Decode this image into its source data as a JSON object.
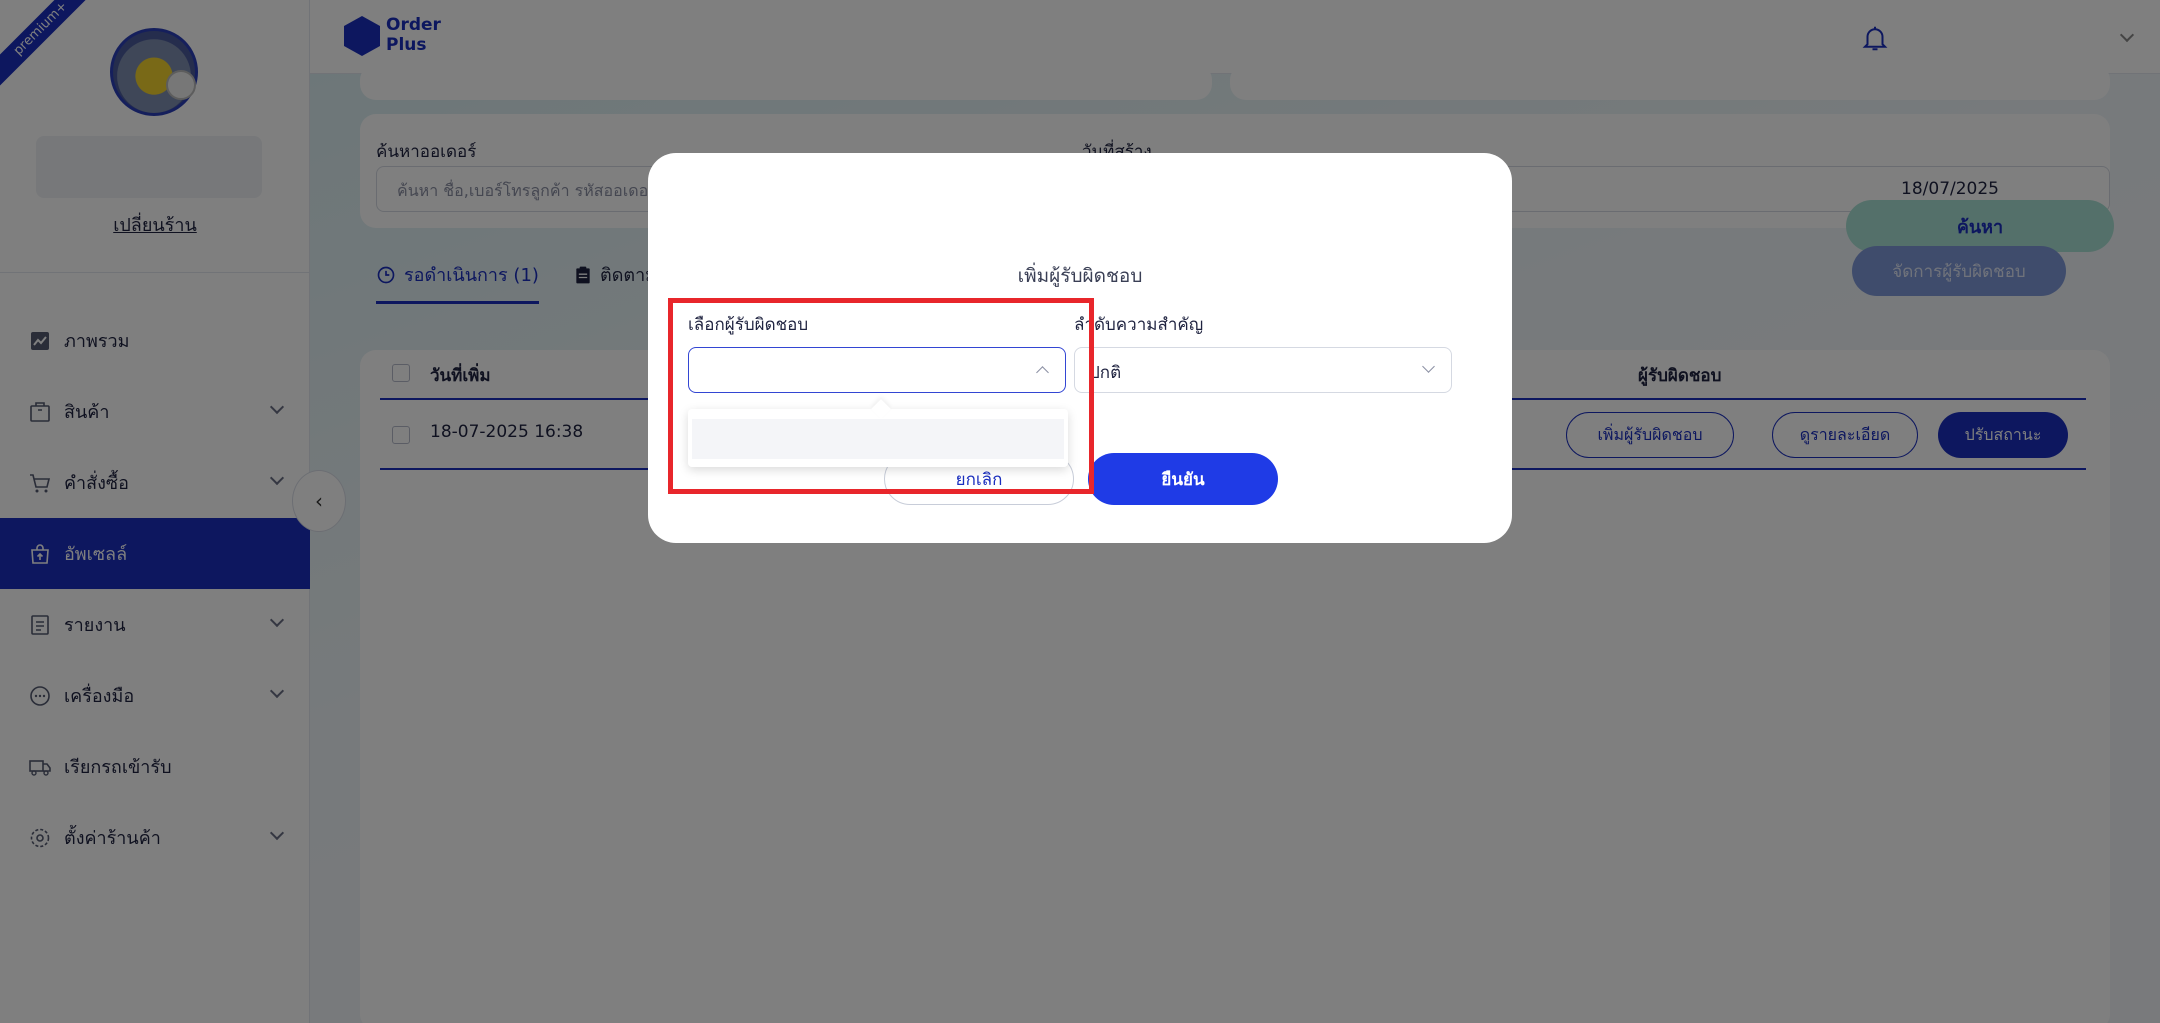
{
  "sidebar": {
    "ribbon": "premium+",
    "change_shop": "เปลี่ยนร้าน",
    "items": [
      {
        "label": "ภาพรวม",
        "icon": "chart-icon",
        "chevron": false
      },
      {
        "label": "สินค้า",
        "icon": "box-icon",
        "chevron": true
      },
      {
        "label": "คำสั่งซื้อ",
        "icon": "cart-icon",
        "chevron": true
      },
      {
        "label": "อัพเซลล์",
        "icon": "upsell-bag-icon",
        "chevron": false,
        "active": true
      },
      {
        "label": "รายงาน",
        "icon": "report-icon",
        "chevron": true
      },
      {
        "label": "เครื่องมือ",
        "icon": "chat-icon",
        "chevron": true
      },
      {
        "label": "เรียกรถเข้ารับ",
        "icon": "truck-icon",
        "chevron": false
      },
      {
        "label": "ตั้งค่าร้านค้า",
        "icon": "gear-icon",
        "chevron": true
      }
    ]
  },
  "topbar": {
    "logo_line1": "Order",
    "logo_line2": "Plus"
  },
  "search": {
    "label": "ค้นหาออเดอร์",
    "placeholder": "ค้นหา ชื่อ,เบอร์โทรลูกค้า รหัสออเดอร์",
    "date_label": "วันที่สร้าง",
    "date_value": "18/07/2025",
    "button": "ค้นหา"
  },
  "tabs": {
    "waiting": "รอดำเนินการ (1)",
    "follow": "ติดตาม"
  },
  "manage_button": "จัดการผู้รับผิดชอบ",
  "table": {
    "col_date": "วันที่เพิ่ม",
    "col_assignee": "ผู้รับผิดชอบ",
    "row": {
      "date": "18-07-2025 16:38",
      "add_assignee": "เพิ่มผู้รับผิดชอบ",
      "view_detail": "ดูรายละเอียด",
      "update_status": "ปรับสถานะ"
    }
  },
  "modal": {
    "title": "เพิ่มผู้รับผิดชอบ",
    "field1_label": "เลือกผู้รับผิดชอบ",
    "field2_label": "ลำดับความสำคัญ",
    "field2_value": "ปกติ",
    "cancel": "ยกเลิก",
    "confirm": "ยืนยัน"
  },
  "colors": {
    "brand": "#1b2fbf",
    "highlight": "#e8262b"
  }
}
